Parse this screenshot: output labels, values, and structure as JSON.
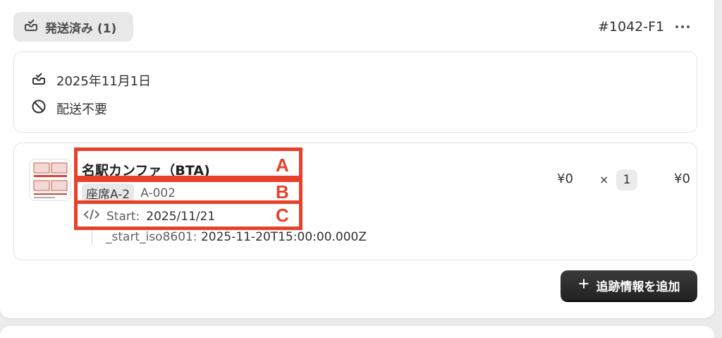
{
  "header": {
    "status_label": "発送済み (1)",
    "order_id": "#1042-F1"
  },
  "fulfillment": {
    "date": "2025年11月1日",
    "shipping": "配送不要"
  },
  "line_item": {
    "title": "名駅カンファ（BTA)",
    "variant_tag": "座席A-2",
    "sku": "A-002",
    "property_label": "Start:",
    "property_value": "2025/11/21",
    "property2_label": "_start_iso8601:",
    "property2_value": "2025-11-20T15:00:00.000Z",
    "price": "¥0",
    "times": "×",
    "quantity": "1",
    "total": "¥0"
  },
  "annotations": {
    "a": "A",
    "b": "B",
    "c": "C"
  },
  "actions": {
    "add_tracking_label": "追跡情報を追加"
  },
  "colors": {
    "annotation": "#e8412a",
    "button_bg": "#2a2a2a"
  }
}
